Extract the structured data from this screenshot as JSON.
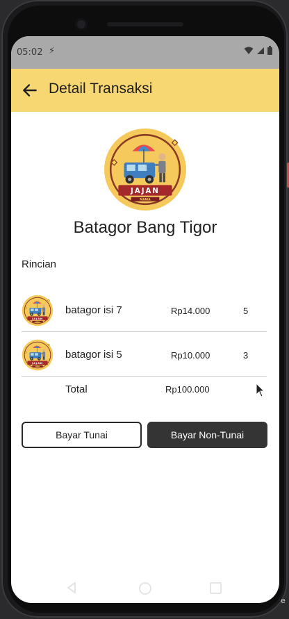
{
  "status_bar": {
    "time": "05:02"
  },
  "app_bar": {
    "title": "Detail Transaksi"
  },
  "store": {
    "name": "Batagor Bang Tigor",
    "logo_text": "JAJAN",
    "logo_subtext": "MANIA"
  },
  "section": {
    "label": "Rincian"
  },
  "items": [
    {
      "name": "batagor isi 7",
      "price": "Rp14.000",
      "qty": "5"
    },
    {
      "name": "batagor isi 5",
      "price": "Rp10.000",
      "qty": "3"
    }
  ],
  "total": {
    "label": "Total",
    "value": "Rp100.000"
  },
  "buttons": {
    "cash": "Bayar Tunai",
    "non_cash": "Bayar Non-Tunai"
  },
  "colors": {
    "app_bar": "#f6d772",
    "primary_dark": "#343434",
    "status_bar": "#a9a9a9"
  },
  "corner": {
    "text": "e"
  }
}
